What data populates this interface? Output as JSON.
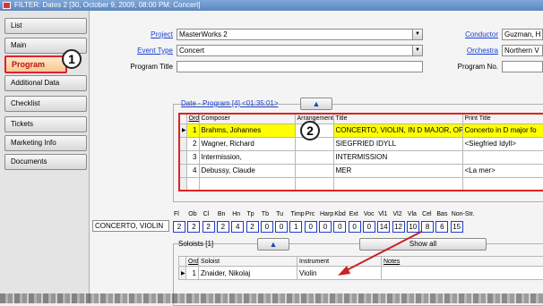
{
  "window": {
    "title": "FILTER: Dates 2 [30, October 9, 2009, 08:00 PM: Concert]"
  },
  "sidebar": {
    "items": [
      {
        "label": "List"
      },
      {
        "label": "Main"
      },
      {
        "label": "Program"
      },
      {
        "label": "Additional Data"
      },
      {
        "label": "Checklist"
      },
      {
        "label": "Tickets"
      },
      {
        "label": "Marketing Info"
      },
      {
        "label": "Documents"
      }
    ],
    "active": "Program"
  },
  "callouts": {
    "one": "1",
    "two": "2"
  },
  "form": {
    "project_label": "Project",
    "project_value": "MasterWorks  2",
    "event_type_label": "Event Type",
    "event_type_value": "Concert",
    "program_title_label": "Program Title",
    "program_title_value": "",
    "conductor_label": "Conductor",
    "conductor_value": "Guzman, H",
    "orchestra_label": "Orchestra",
    "orchestra_value": "Northern V",
    "program_no_label": "Program No.",
    "program_no_value": ""
  },
  "program": {
    "section_title": "Date - Program  [4]   <01:35:01>",
    "columns": [
      "Order",
      "Composer",
      "Arrangement",
      "Title",
      "Print Title"
    ],
    "rows": [
      {
        "order": "1",
        "composer": "Brahms, Johannes",
        "arrangement": "",
        "title": "CONCERTO, VIOLIN, IN D MAJOR, OP",
        "print_title": "Concerto in D major fo",
        "selected": true
      },
      {
        "order": "2",
        "composer": "Wagner, Richard",
        "arrangement": "",
        "title": "SIEGFRIED IDYLL",
        "print_title": "<Siegfried Idyll>",
        "selected": false
      },
      {
        "order": "3",
        "composer": "Intermission,",
        "arrangement": "",
        "title": "INTERMISSION",
        "print_title": "",
        "selected": false
      },
      {
        "order": "4",
        "composer": "Debussy, Claude",
        "arrangement": "",
        "title": "MER",
        "print_title": "<La mer>",
        "selected": false
      }
    ]
  },
  "instrumentation": {
    "work": "CONCERTO, VIOLIN",
    "headers": [
      "Fl",
      "Ob",
      "Cl",
      "Bn",
      "Hn",
      "Tp",
      "Tb",
      "Tu",
      "Timp",
      "Prc",
      "Harp",
      "Kbd",
      "Ext",
      "Voc",
      "Vl1",
      "Vl2",
      "Vla",
      "Cel",
      "Bas",
      "Non-Str."
    ],
    "values": [
      "2",
      "2",
      "2",
      "2",
      "4",
      "2",
      "0",
      "0",
      "1",
      "0",
      "0",
      "0",
      "0",
      "0",
      "14",
      "12",
      "10",
      "8",
      "6",
      "15"
    ]
  },
  "soloists": {
    "section_title": "Soloists  [1]",
    "show_all_label": "Show all",
    "columns": [
      "Order",
      "Soloist",
      "Instrument",
      "Notes"
    ],
    "rows": [
      {
        "order": "1",
        "soloist": "Znaider, Nikolaj",
        "instrument": "Violin",
        "notes": ""
      }
    ]
  },
  "colors": {
    "selected_row": "#ffff00",
    "link": "#1a3fd0",
    "highlight_border": "#dd2222",
    "arrow": "#cc2222"
  }
}
